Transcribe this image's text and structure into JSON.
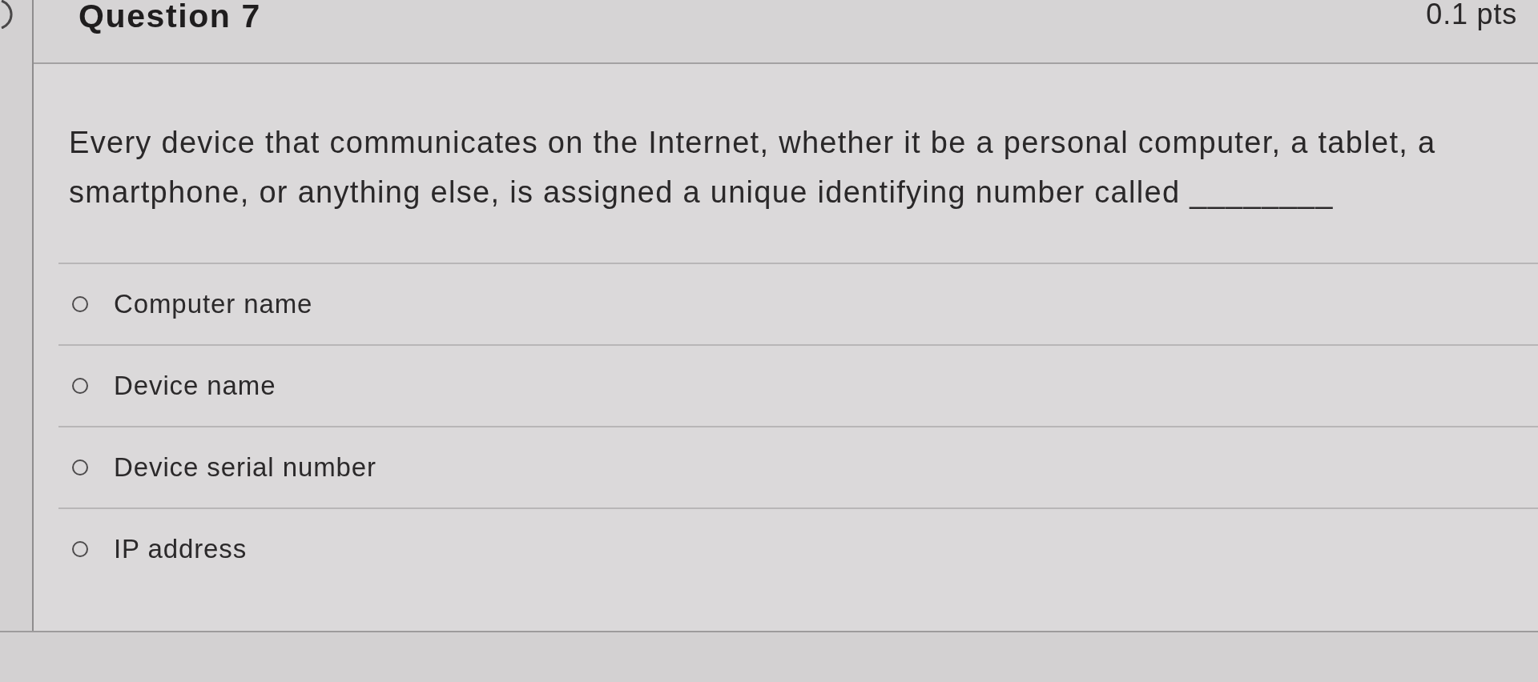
{
  "question": {
    "title": "Question 7",
    "points": "0.1 pts",
    "text": "Every device that communicates on the Internet, whether it be a personal computer, a tablet, a smartphone, or anything else, is assigned a unique identifying number called ________"
  },
  "answers": [
    {
      "label": "Computer name",
      "selected": false
    },
    {
      "label": "Device name",
      "selected": false
    },
    {
      "label": "Device serial number",
      "selected": false
    },
    {
      "label": "IP address",
      "selected": false
    }
  ]
}
